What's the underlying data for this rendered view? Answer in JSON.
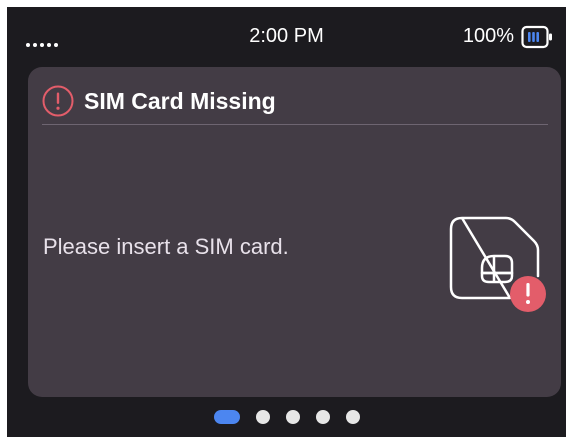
{
  "status_bar": {
    "time": "2:00 PM",
    "battery_percent": "100%",
    "battery_level": 1.0,
    "signal_icon": "signal-dots-icon",
    "battery_icon": "battery-icon"
  },
  "alert": {
    "title": "SIM Card Missing",
    "message": "Please insert a SIM card.",
    "warning_icon": "warning-circle-icon",
    "illustration_icon": "sim-card-error-icon"
  },
  "pager": {
    "page_count": 5,
    "active_index": 0
  },
  "colors": {
    "background": "#1c1b1f",
    "card": "#433c45",
    "warning": "#e35d6a",
    "accent": "#4c86f0",
    "battery": "#4c86f0"
  }
}
